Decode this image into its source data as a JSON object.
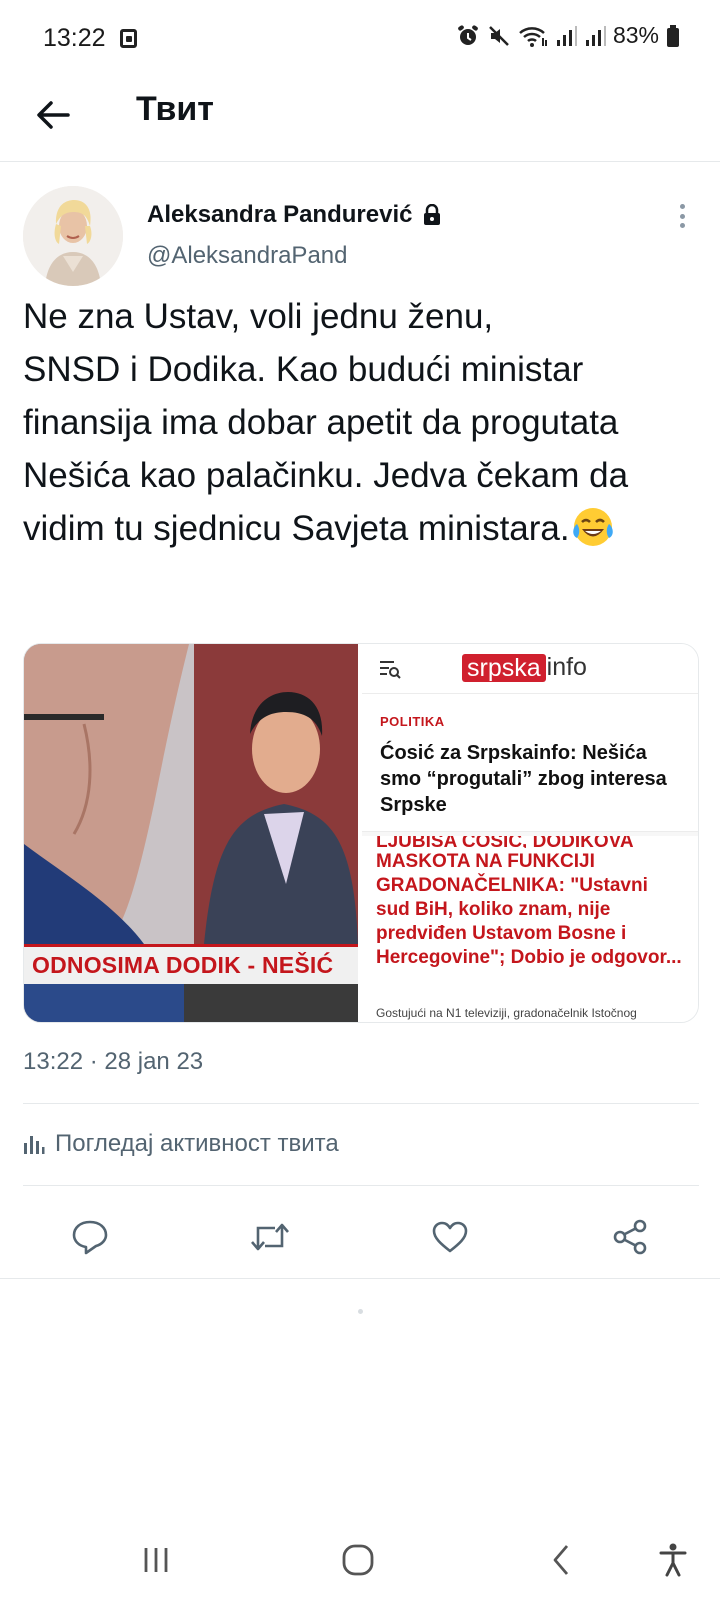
{
  "status_bar": {
    "time": "13:22",
    "battery": "83%",
    "icons": [
      "screenshot-icon",
      "alarm-icon",
      "mute-icon",
      "wifi-icon",
      "signal-icon",
      "signal-icon",
      "battery-icon"
    ]
  },
  "header": {
    "title": "Твит",
    "back_icon": "arrow-left-icon"
  },
  "tweet": {
    "author_name": "Aleksandra Pandurević",
    "author_handle": "@AleksandraPand",
    "protected_icon": "lock-icon",
    "text": "Ne zna Ustav, voli jednu ženu,\nSNSD i Dodika. Kao budući ministar finansija ima dobar apetit da progutata Nešića kao palačinku. Jedva čekam da vidim tu sjednicu Savjeta ministara.",
    "emoji": "face-with-tears-of-joy",
    "timestamp": "13:22 · 28 jan 23",
    "analytics_label": "Погледај активност твита"
  },
  "media": {
    "tv_banner": "ODNOSIMA DODIK - NEŠIĆ",
    "site_logo_box": "srpska",
    "site_logo_rest": "info",
    "category": "POLITIKA",
    "headline": "Ćosić za Srpskainfo: Nešića smo “progutali” zbog interesa Srpske",
    "cut_line": "LJUBIŠA ĆOSIĆ, DODIKOVA",
    "red_text": "MASKOTA NA FUNKCIJI GRADONAČELNIKA: \"Ustavni sud BiH, koliko znam, nije predviđen Ustavom Bosne i Hercegovine\"; Dobio je odgovor...",
    "snippet": "Gostujući na N1 televiziji, gradonačelnik Istočnog"
  },
  "actions": {
    "items": [
      "reply-icon",
      "retweet-icon",
      "like-icon",
      "share-icon"
    ]
  },
  "colors": {
    "text_primary": "#0f1419",
    "text_secondary": "#536471",
    "divider": "#e6e9eb",
    "srpska_red": "#c4161c"
  },
  "nav": {
    "items": [
      "recent-apps-icon",
      "home-icon",
      "back-icon",
      "accessibility-icon"
    ]
  }
}
